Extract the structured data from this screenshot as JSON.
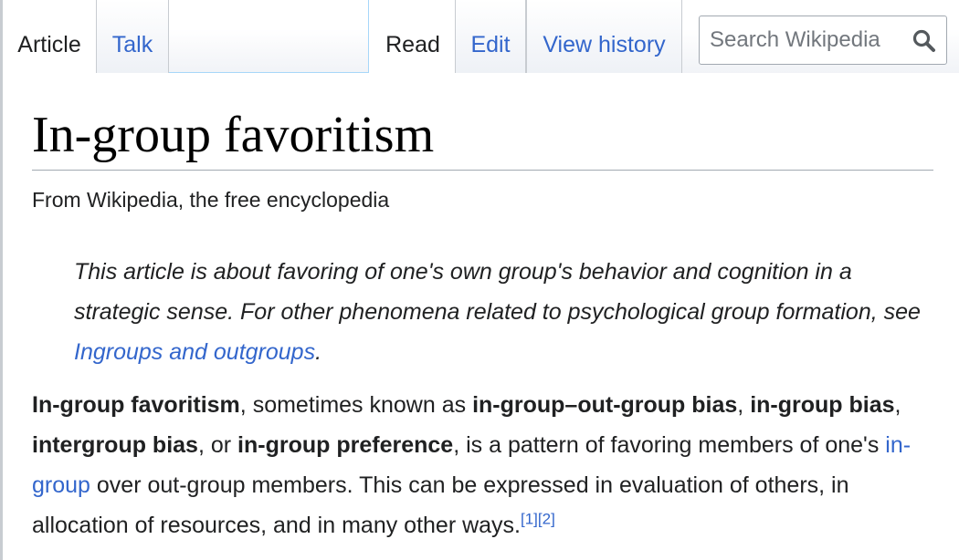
{
  "tabs": {
    "article": "Article",
    "talk": "Talk",
    "read": "Read",
    "edit": "Edit",
    "view_history": "View history"
  },
  "search": {
    "placeholder": "Search Wikipedia",
    "icon": "magnifier-icon"
  },
  "page": {
    "title": "In-group favoritism",
    "tagline": "From Wikipedia, the free encyclopedia"
  },
  "hatnote": {
    "text_before": "This article is about favoring of one's own group's behavior and cognition in a strategic sense. For other phenomena related to psychological group formation, see ",
    "link": "Ingroups and outgroups",
    "text_after": "."
  },
  "lead": {
    "term1": "In-group favoritism",
    "t1": ", sometimes known as ",
    "term2": "in-group–out-group bias",
    "t2": ", ",
    "term3": "in-group bias",
    "t3": ", ",
    "term4": "intergroup bias",
    "t4": ", or ",
    "term5": "in-group preference",
    "t5": ", is a pattern of favoring members of one's ",
    "link": "in-group",
    "t6": " over out-group members. This can be expressed in evaluation of others, in allocation of resources, and in many other ways.",
    "ref1": "[1]",
    "ref2": "[2]"
  },
  "colors": {
    "link": "#3366cc",
    "text": "#202122",
    "border": "#a2a9b1",
    "tab_border": "#a7d7f9"
  }
}
